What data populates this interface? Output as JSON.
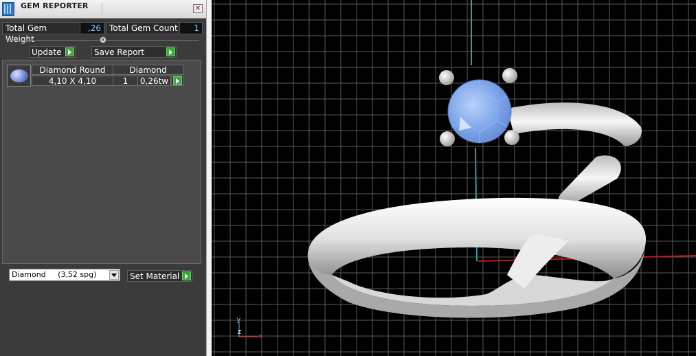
{
  "window": {
    "title": "GEM REPORTER",
    "close_glyph": "✕"
  },
  "stats": {
    "weight_label": "Total Gem Weight",
    "weight_value": ",26",
    "count_label": "Total Gem Count",
    "count_value": "1"
  },
  "actions": {
    "update_label": "Update",
    "save_report_label": "Save Report"
  },
  "gem_table": {
    "rows": [
      {
        "shape": "Diamond Round",
        "material": "Diamond",
        "size": "4,10 X 4,10",
        "count": "1",
        "weight": "0,26tw"
      }
    ]
  },
  "material": {
    "selected": "Diamond     (3,52 spg)",
    "set_material_label": "Set Material"
  },
  "viewport": {
    "axis_labels": {
      "y": "y",
      "z": "z",
      "x": "x"
    },
    "colors": {
      "background": "#000000",
      "grid": "#5a5a5a",
      "x_axis": "#c01818",
      "y_axis": "#2aa0a8",
      "gem": "#7ba3e8",
      "metal": "#e8e8e8"
    }
  },
  "icons": {
    "app": "gem-reporter-app-icon",
    "close": "close-icon",
    "slider": "slider-knob",
    "go": "green-arrow-icon",
    "dropdown": "chevron-down-icon",
    "thumbnail": "round-gem-thumbnail"
  }
}
